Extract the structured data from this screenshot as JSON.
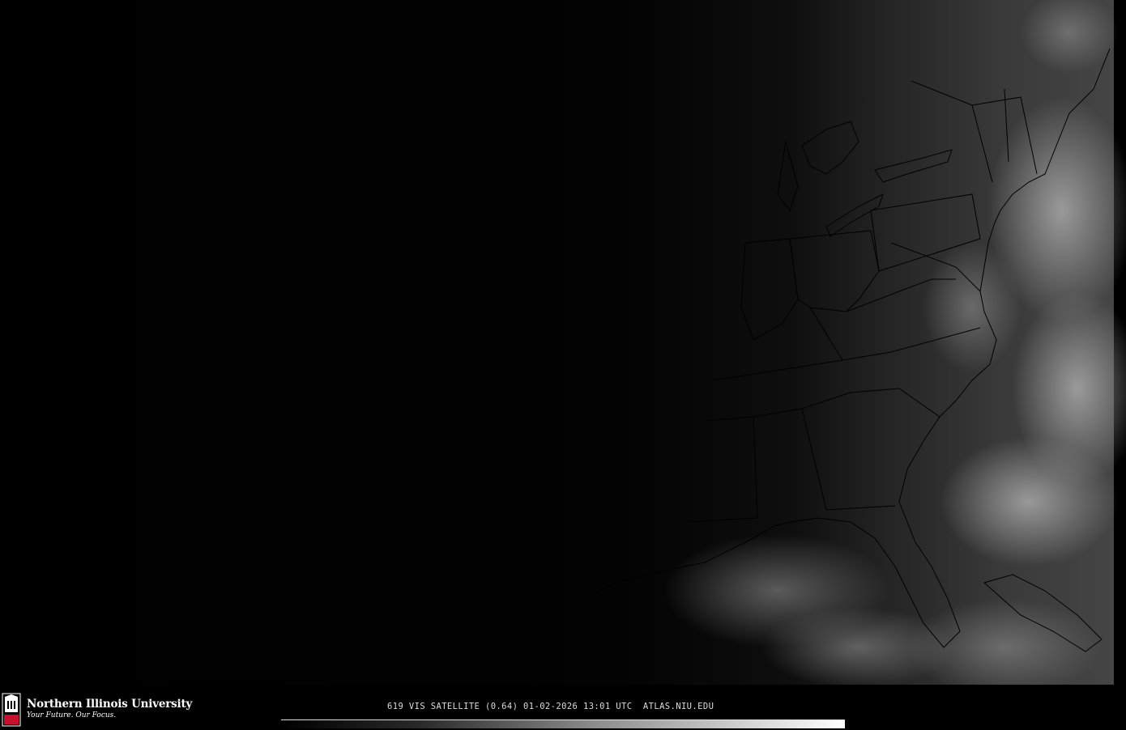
{
  "branding": {
    "university_name": "Northern Illinois University",
    "tagline": "Your Future. Our Focus.",
    "logo_text": "NIU",
    "logo_color": "#c8102e"
  },
  "caption": {
    "text": "619 VIS SATELLITE (0.64) 01-02-2026 13:01 UTC  ATLAS.NIU.EDU"
  },
  "map": {
    "product": "visible satellite imagery",
    "region": "eastern United States",
    "background_color": "#000000",
    "land_color_night": "#050505",
    "cloud_color": "#c8c8c8",
    "boundary_color": "#000000"
  },
  "colorbar": {
    "palette": "grayscale",
    "min_color": "#000000",
    "max_color": "#ffffff"
  }
}
